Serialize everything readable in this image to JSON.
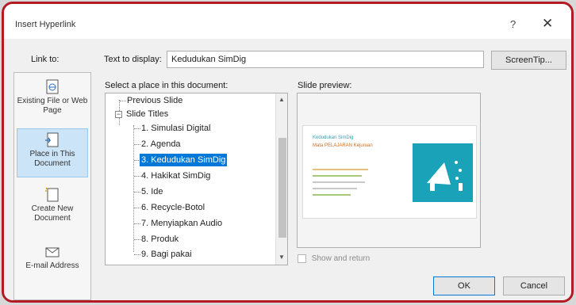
{
  "window": {
    "title": "Insert Hyperlink",
    "help_label": "?",
    "close_label": "✕"
  },
  "link_to": {
    "label": "Link to:",
    "items": [
      {
        "label": "Existing File or Web Page",
        "icon": "web-page-icon",
        "selected": false
      },
      {
        "label": "Place in This Document",
        "icon": "document-place-icon",
        "selected": true
      },
      {
        "label": "Create New Document",
        "icon": "new-document-icon",
        "selected": false
      },
      {
        "label": "E-mail Address",
        "icon": "email-icon",
        "selected": false
      }
    ]
  },
  "text_to_display": {
    "label": "Text to display:",
    "value": "Kedudukan SimDig"
  },
  "screentip_label": "ScreenTip...",
  "place_tree": {
    "label": "Select a place in this document:",
    "rows": [
      "Previous Slide",
      "Slide Titles",
      "1. Simulasi Digital",
      "2. Agenda",
      "3. Kedudukan SimDig",
      "4. Hakikat SimDig",
      "5. Ide",
      "6. Recycle-Botol",
      "7. Menyiapkan Audio",
      "8. Produk",
      "9. Bagi pakai"
    ],
    "selected_index": 4,
    "expander": "−"
  },
  "slide_preview": {
    "label": "Slide preview:",
    "thumb_title": "Kedudukan SimDig",
    "thumb_subtitle": "Mata PELAJARAN Kejuruan",
    "accent_color": "#1aa3b8"
  },
  "show_and_return_label": "Show and return",
  "ok_label": "OK",
  "cancel_label": "Cancel"
}
